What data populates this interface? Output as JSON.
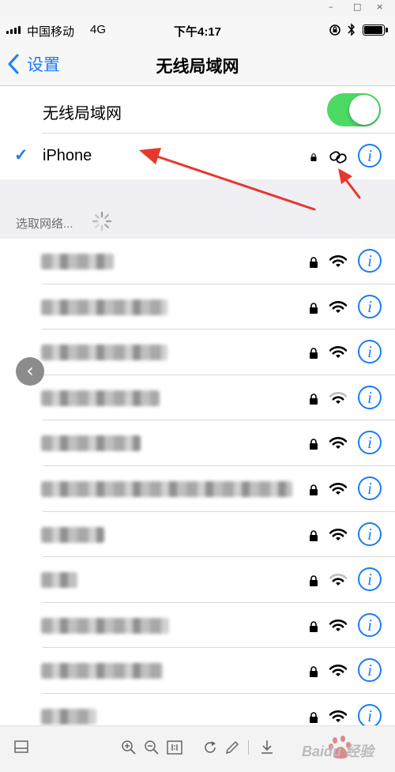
{
  "status_bar": {
    "carrier": "中国移动",
    "network": "4G",
    "time": "下午4:17"
  },
  "nav": {
    "back_label": "设置",
    "title": "无线局域网"
  },
  "wifi_toggle": {
    "label": "无线局域网",
    "on": true,
    "color": "#4cd964"
  },
  "connected": {
    "name": "iPhone",
    "check": "✓",
    "secured": true,
    "icon": "hotspot-link-icon"
  },
  "section": {
    "header": "选取网络..."
  },
  "networks": [
    {
      "name": "",
      "secured": true,
      "signal": 3
    },
    {
      "name": "",
      "secured": true,
      "signal": 3
    },
    {
      "name": "",
      "secured": true,
      "signal": 3
    },
    {
      "name": "",
      "secured": true,
      "signal": 2
    },
    {
      "name": "",
      "secured": true,
      "signal": 3
    },
    {
      "name": "",
      "secured": true,
      "signal": 3
    },
    {
      "name": "",
      "secured": true,
      "signal": 3
    },
    {
      "name": "",
      "secured": true,
      "signal": 2
    },
    {
      "name": "",
      "secured": true,
      "signal": 3
    },
    {
      "name": "",
      "secured": true,
      "signal": 3
    },
    {
      "name": "",
      "secured": true,
      "signal": 3
    }
  ],
  "info_glyph": "i",
  "accent_color": "#1a7cf5",
  "annotation_color": "#e8372e",
  "window_controls": [
    "–",
    "□",
    "×"
  ],
  "toolbar_icons": [
    "layout-icon",
    "zoom-in-icon",
    "zoom-out-icon",
    "actual-size-icon",
    "rotate-icon",
    "pen-icon",
    "download-icon"
  ],
  "watermark": "Baidu 经验"
}
